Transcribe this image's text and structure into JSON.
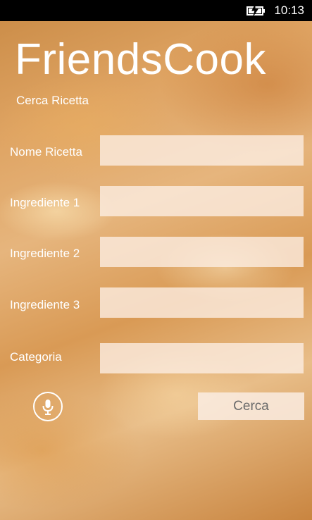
{
  "status_bar": {
    "time": "10:13",
    "battery_icon": "battery-charging-icon"
  },
  "app": {
    "title": "FriendsCook",
    "subtitle": "Cerca Ricetta"
  },
  "form": {
    "fields": [
      {
        "label": "Nome Ricetta",
        "value": ""
      },
      {
        "label": "Ingrediente 1",
        "value": ""
      },
      {
        "label": "Ingrediente 2",
        "value": ""
      },
      {
        "label": "Ingrediente 3",
        "value": ""
      },
      {
        "label": "Categoria",
        "value": ""
      }
    ],
    "mic_icon": "microphone-icon",
    "search_button_label": "Cerca"
  },
  "colors": {
    "field_background": "#fdeee4",
    "button_text": "#6a6a6a",
    "status_bar": "#000000"
  }
}
